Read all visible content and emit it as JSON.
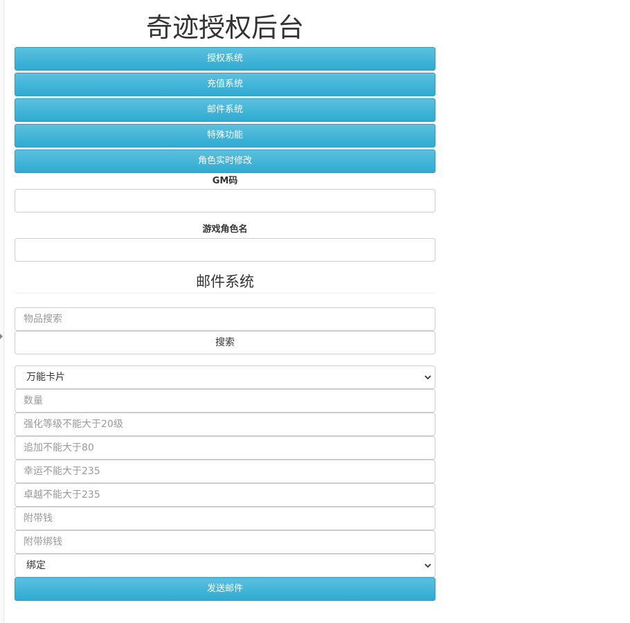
{
  "header": {
    "title": "奇迹授权后台"
  },
  "nav": {
    "buttons": [
      {
        "label": "授权系统"
      },
      {
        "label": "充值系统"
      },
      {
        "label": "邮件系统"
      },
      {
        "label": "特殊功能"
      },
      {
        "label": "角色实时修改"
      }
    ]
  },
  "form": {
    "gm_label": "GM码",
    "gm_value": "",
    "role_label": "游戏角色名",
    "role_value": ""
  },
  "mail": {
    "section_title": "邮件系统",
    "search_placeholder": "物品搜索",
    "search_button": "搜索",
    "item_select_value": "万能卡片",
    "fields": [
      {
        "placeholder": "数量"
      },
      {
        "placeholder": "强化等级不能大于20级"
      },
      {
        "placeholder": "追加不能大于80"
      },
      {
        "placeholder": "幸运不能大于235"
      },
      {
        "placeholder": "卓越不能大于235"
      },
      {
        "placeholder": "附带钱"
      },
      {
        "placeholder": "附带绑钱"
      }
    ],
    "bind_select_value": "绑定",
    "send_button": "发送邮件"
  },
  "colors": {
    "primary_button": "#2eabd3",
    "primary_button_light": "#5bc0de",
    "border": "#cccccc"
  },
  "icons": {
    "select_arrow": "chevron-down-icon",
    "sidebar_toggle": "caret-right-icon"
  }
}
